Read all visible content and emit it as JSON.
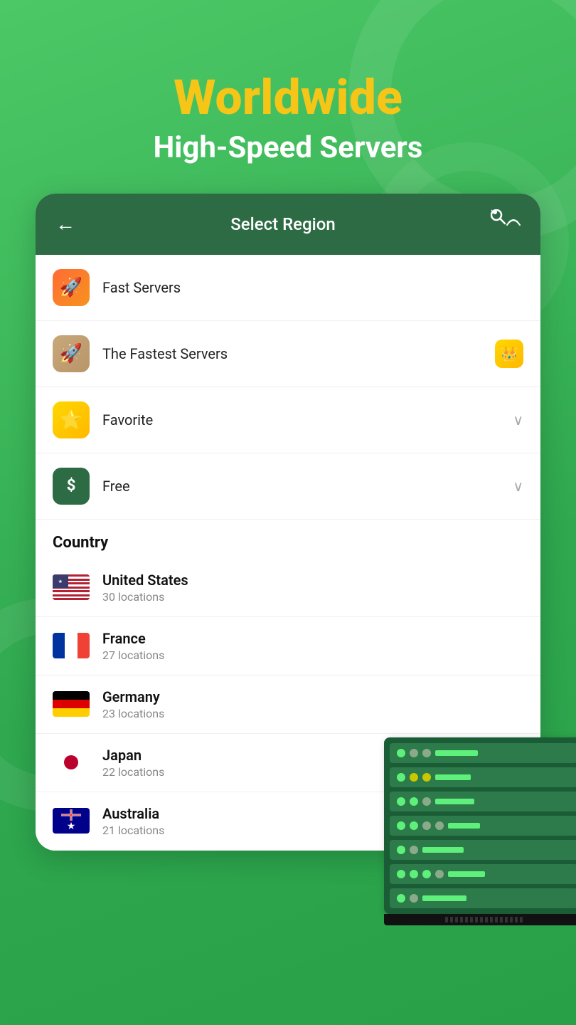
{
  "hero": {
    "title": "Worldwide",
    "subtitle": "High-Speed Servers"
  },
  "header": {
    "title": "Select Region",
    "back_label": "←"
  },
  "menu_items": [
    {
      "id": "fast-servers",
      "label": "Fast Servers",
      "icon": "🚀",
      "icon_class": "icon-fast",
      "has_chevron": false,
      "has_crown": false
    },
    {
      "id": "fastest-servers",
      "label": "The Fastest Servers",
      "icon": "🚀",
      "icon_class": "icon-fastest",
      "has_chevron": false,
      "has_crown": true
    },
    {
      "id": "favorite",
      "label": "Favorite",
      "icon": "⭐",
      "icon_class": "icon-favorite",
      "has_chevron": true,
      "has_crown": false
    },
    {
      "id": "free",
      "label": "Free",
      "icon": "$",
      "icon_class": "icon-free",
      "has_chevron": true,
      "has_crown": false
    }
  ],
  "section_label": "Country",
  "countries": [
    {
      "name": "United States",
      "locations": "30 locations",
      "flag": "us"
    },
    {
      "name": "France",
      "locations": "27 locations",
      "flag": "fr"
    },
    {
      "name": "Germany",
      "locations": "23 locations",
      "flag": "de"
    },
    {
      "name": "Japan",
      "locations": "22 locations",
      "flag": "jp"
    },
    {
      "name": "Australia",
      "locations": "21 locations",
      "flag": "au"
    }
  ]
}
